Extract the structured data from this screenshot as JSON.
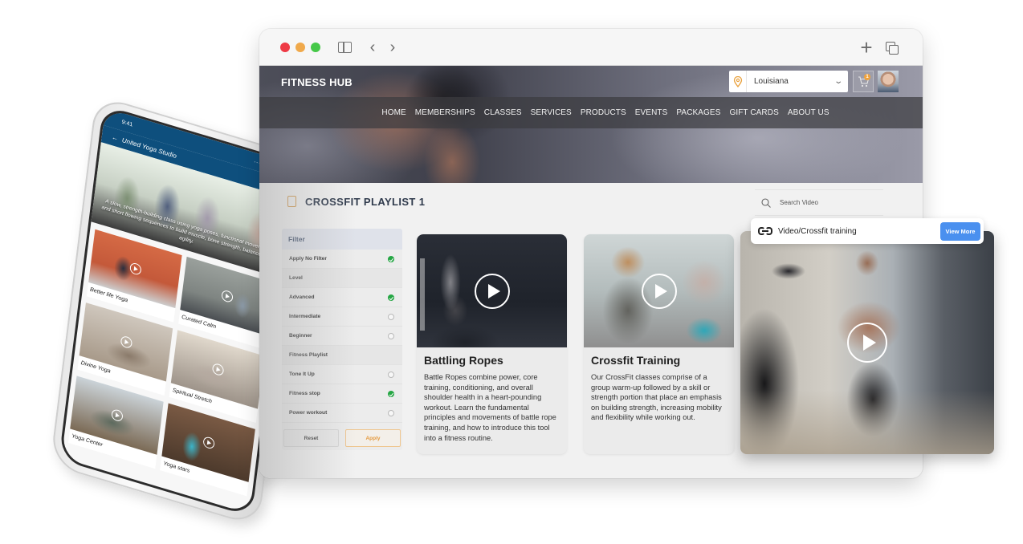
{
  "browser": {
    "toolbar": {
      "traffic_lights": [
        "close",
        "minimize",
        "maximize"
      ],
      "icons": [
        "sidebar-icon",
        "back-icon",
        "forward-icon",
        "new-tab-icon",
        "tabs-overview-icon"
      ],
      "back_glyph": "‹",
      "forward_glyph": "›",
      "plus_glyph": "+"
    },
    "site": {
      "brand": "FITNESS HUB",
      "location": {
        "value": "Louisiana",
        "chevron": "⌄"
      },
      "cart": {
        "badge": "1"
      },
      "nav": [
        "HOME",
        "MEMBERSHIPS",
        "CLASSES",
        "SERVICES",
        "PRODUCTS",
        "EVENTS",
        "PACKAGES",
        "GIFT CARDS",
        "ABOUT US"
      ],
      "playlist_title": "CROSSFIT PLAYLIST 1",
      "search": {
        "placeholder": "Search Video"
      },
      "filter": {
        "title": "Filter",
        "rows": [
          {
            "label": "Apply No Filter",
            "type": "option",
            "selected": true
          },
          {
            "label": "Level",
            "type": "section"
          },
          {
            "label": "Advanced",
            "type": "option",
            "selected": true
          },
          {
            "label": "Intermediate",
            "type": "option",
            "selected": false
          },
          {
            "label": "Beginner",
            "type": "option",
            "selected": false
          },
          {
            "label": "Fitness Playlist",
            "type": "section"
          },
          {
            "label": "Tone It Up",
            "type": "option",
            "selected": false
          },
          {
            "label": "Fitness stop",
            "type": "option",
            "selected": true
          },
          {
            "label": "Power workout",
            "type": "option",
            "selected": false
          }
        ],
        "reset_label": "Reset",
        "apply_label": "Apply"
      },
      "cards": [
        {
          "title": "Battling Ropes",
          "body": "Battle Ropes combine power, core training, conditioning, and overall shoulder health in a heart-pounding workout. Learn the fundamental principles and movements of battle rope training, and how to introduce this tool into a fitness routine."
        },
        {
          "title": "Crossfit Training",
          "body": "Our CrossFit classes comprise of a group warm-up followed by a skill or strength portion that place an emphasis on building strength, increasing mobility and flexibility while working out."
        }
      ]
    }
  },
  "overlay": {
    "link_text": "Video/Crossfit training",
    "view_more_label": "View More"
  },
  "phone": {
    "time": "9:41",
    "status_icons": "..ıl ≋ ▬",
    "back_glyph": "←",
    "title": "United Yoga Studio",
    "actions": "⚲ ⛛",
    "hero_text": "A slow, strength-building class using yoga poses, functional movement, and short flowing sequences to build muscle, bone strength, balance, and agility.",
    "tiles": [
      "Better life Yoga",
      "Curated Calm",
      "Divine Yoga",
      "Spiritual Stretch",
      "Yoga Center",
      "Yoga stars"
    ]
  },
  "colors": {
    "brand_blue": "#0e4f7d",
    "accent_orange": "#e59a3e",
    "check_green": "#25a644",
    "view_more_blue": "#4a90ef"
  }
}
